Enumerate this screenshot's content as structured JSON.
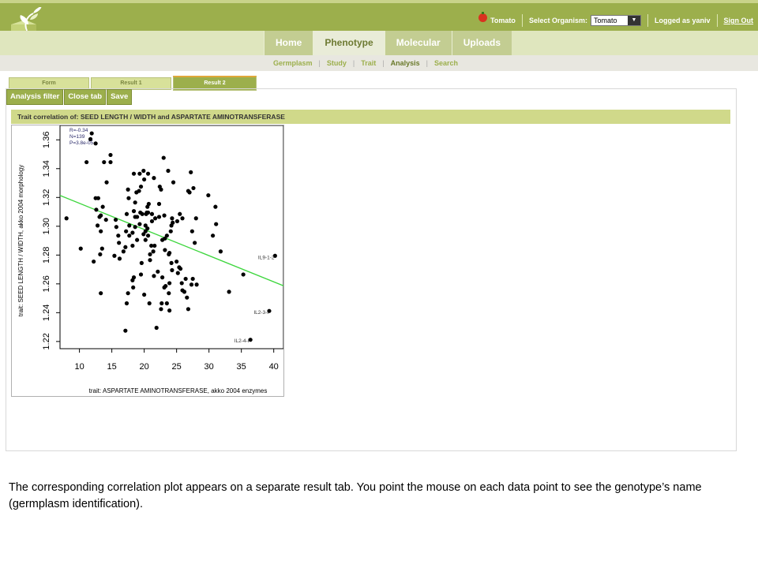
{
  "header": {
    "logo_icon": "leaf-logo-icon",
    "organism_label_brand": "Tomato",
    "select_organism_label": "Select Organism:",
    "organism_value": "Tomato",
    "logged_in_text": "Logged as yaniv",
    "signout_label": "Sign Out",
    "colors": {
      "header": "#9caf4c",
      "nav_band": "#dfe6be",
      "tab_active": "#e9ecd8",
      "accent": "#9caf4c"
    }
  },
  "nav": {
    "tabs": [
      {
        "label": "Home"
      },
      {
        "label": "Phenotype"
      },
      {
        "label": "Molecular"
      },
      {
        "label": "Uploads"
      }
    ],
    "subnav": [
      {
        "label": "Germplasm"
      },
      {
        "label": "Study"
      },
      {
        "label": "Trait"
      },
      {
        "label": "Analysis"
      },
      {
        "label": "Search"
      }
    ]
  },
  "inner_tabs": [
    {
      "label": "Form"
    },
    {
      "label": "Result 1"
    },
    {
      "label": "Result 2"
    }
  ],
  "toolbar": {
    "analysis_filter": "Analysis filter",
    "close_tab": "Close tab",
    "save": "Save"
  },
  "correlation_title": "Trait correlation of: SEED LENGTH / WIDTH and ASPARTATE AMINOTRANSFERASE",
  "caption": "The corresponding correlation plot appears on a separate result tab. You point the mouse on each data point to see the genotype’s name (germplasm identification).",
  "chart_data": {
    "type": "scatter",
    "xlabel": "trait: ASPARTATE AMINOTRANSFERASE, akko 2004 enzymes",
    "ylabel": "trait: SEED LENGTH / WIDTH, akko 2004 morphology",
    "xlim": [
      7,
      41.5
    ],
    "ylim": [
      1.215,
      1.37
    ],
    "xticks": [
      10,
      15,
      20,
      25,
      30,
      35,
      40
    ],
    "yticks": [
      1.22,
      1.24,
      1.26,
      1.28,
      1.3,
      1.32,
      1.34,
      1.36
    ],
    "stats": [
      "R=-0.34",
      "N=139",
      "P=3.8e-05"
    ],
    "regression_line": {
      "x": [
        7,
        41.5
      ],
      "y": [
        1.3214,
        1.2587
      ],
      "color": "#3dd63d"
    },
    "annotations": [
      {
        "text": "IL9-1-2",
        "x": 40.1,
        "y": 1.2793
      },
      {
        "text": "IL2-3-I",
        "x": 39.2,
        "y": 1.2412
      },
      {
        "text": "IL2-4-I",
        "x": 36.2,
        "y": 1.2215
      }
    ],
    "points": [
      [
        11.7,
        1.3605
      ],
      [
        11.9,
        1.3645
      ],
      [
        12.5,
        1.3575
      ],
      [
        11.1,
        1.3445
      ],
      [
        13.8,
        1.3445
      ],
      [
        14.8,
        1.3445
      ],
      [
        14.8,
        1.3495
      ],
      [
        14.2,
        1.3305
      ],
      [
        12.5,
        1.3195
      ],
      [
        12.9,
        1.3195
      ],
      [
        12.6,
        1.3115
      ],
      [
        13.6,
        1.3135
      ],
      [
        13.3,
        1.3075
      ],
      [
        13.1,
        1.3065
      ],
      [
        12.8,
        1.3005
      ],
      [
        14.1,
        1.3045
      ],
      [
        13.3,
        1.2965
      ],
      [
        13.5,
        1.2845
      ],
      [
        13.2,
        1.2805
      ],
      [
        12.2,
        1.2755
      ],
      [
        10.2,
        1.2845
      ],
      [
        8.0,
        1.3055
      ],
      [
        13.3,
        1.2535
      ],
      [
        15.7,
        1.2995
      ],
      [
        15.6,
        1.3045
      ],
      [
        17.3,
        1.3085
      ],
      [
        16.0,
        1.2935
      ],
      [
        16.8,
        1.2825
      ],
      [
        16.1,
        1.2885
      ],
      [
        15.4,
        1.2795
      ],
      [
        16.2,
        1.2775
      ],
      [
        17.2,
        1.2965
      ],
      [
        18.2,
        1.2955
      ],
      [
        18.6,
        1.3065
      ],
      [
        18.4,
        1.3105
      ],
      [
        18.9,
        1.3065
      ],
      [
        19.4,
        1.3095
      ],
      [
        19.7,
        1.3085
      ],
      [
        20.3,
        1.3085
      ],
      [
        20.6,
        1.3095
      ],
      [
        21.2,
        1.3085
      ],
      [
        21.7,
        1.3055
      ],
      [
        21.2,
        1.3035
      ],
      [
        20.5,
        1.2985
      ],
      [
        20.2,
        1.3005
      ],
      [
        19.9,
        1.2945
      ],
      [
        19.3,
        1.3015
      ],
      [
        18.6,
        1.2995
      ],
      [
        17.7,
        1.3005
      ],
      [
        17.7,
        1.2935
      ],
      [
        18.2,
        1.2865
      ],
      [
        17.1,
        1.2855
      ],
      [
        18.9,
        1.2905
      ],
      [
        20.2,
        1.2965
      ],
      [
        20.6,
        1.2935
      ],
      [
        20.2,
        1.2905
      ],
      [
        21.1,
        1.2865
      ],
      [
        21.6,
        1.2865
      ],
      [
        21.4,
        1.2825
      ],
      [
        20.9,
        1.2805
      ],
      [
        20.9,
        1.2765
      ],
      [
        19.6,
        1.2745
      ],
      [
        19.5,
        1.2665
      ],
      [
        18.4,
        1.2645
      ],
      [
        18.2,
        1.2625
      ],
      [
        18.3,
        1.2575
      ],
      [
        17.5,
        1.2535
      ],
      [
        17.3,
        1.2465
      ],
      [
        17.1,
        1.2275
      ],
      [
        20.0,
        1.2525
      ],
      [
        20.8,
        1.2465
      ],
      [
        21.9,
        1.2295
      ],
      [
        22.1,
        1.2685
      ],
      [
        21.5,
        1.2655
      ],
      [
        22.8,
        1.2645
      ],
      [
        23.3,
        1.2585
      ],
      [
        23.1,
        1.2575
      ],
      [
        23.9,
        1.2605
      ],
      [
        23.8,
        1.2535
      ],
      [
        22.7,
        1.2465
      ],
      [
        23.5,
        1.2465
      ],
      [
        23.9,
        1.2415
      ],
      [
        22.6,
        1.2425
      ],
      [
        24.3,
        1.2695
      ],
      [
        24.2,
        1.2745
      ],
      [
        23.8,
        1.2805
      ],
      [
        23.2,
        1.2835
      ],
      [
        22.8,
        1.2905
      ],
      [
        23.2,
        1.2915
      ],
      [
        23.5,
        1.2935
      ],
      [
        24.1,
        1.2965
      ],
      [
        24.2,
        1.3005
      ],
      [
        24.4,
        1.3025
      ],
      [
        25.1,
        1.3035
      ],
      [
        25.9,
        1.3055
      ],
      [
        25.5,
        1.3085
      ],
      [
        24.3,
        1.3055
      ],
      [
        23.1,
        1.3075
      ],
      [
        22.3,
        1.3065
      ],
      [
        22.3,
        1.3155
      ],
      [
        20.7,
        1.3155
      ],
      [
        20.5,
        1.3135
      ],
      [
        20.4,
        1.3095
      ],
      [
        18.6,
        1.3165
      ],
      [
        17.6,
        1.3195
      ],
      [
        17.5,
        1.3255
      ],
      [
        18.8,
        1.3235
      ],
      [
        19.2,
        1.3245
      ],
      [
        19.5,
        1.3275
      ],
      [
        20.0,
        1.3325
      ],
      [
        19.3,
        1.3365
      ],
      [
        19.9,
        1.3385
      ],
      [
        20.6,
        1.3365
      ],
      [
        18.4,
        1.3365
      ],
      [
        21.5,
        1.3335
      ],
      [
        22.4,
        1.3275
      ],
      [
        22.6,
        1.3255
      ],
      [
        23.7,
        1.3385
      ],
      [
        24.5,
        1.3305
      ],
      [
        23.0,
        1.3475
      ],
      [
        26.8,
        1.3245
      ],
      [
        27.0,
        1.3235
      ],
      [
        27.2,
        1.3375
      ],
      [
        27.6,
        1.3265
      ],
      [
        29.9,
        1.3215
      ],
      [
        31.0,
        1.3135
      ],
      [
        31.1,
        1.3015
      ],
      [
        30.6,
        1.2935
      ],
      [
        28.0,
        1.3055
      ],
      [
        27.4,
        1.2965
      ],
      [
        27.8,
        1.2885
      ],
      [
        31.8,
        1.2825
      ],
      [
        33.1,
        1.2545
      ],
      [
        35.3,
        1.2665
      ],
      [
        25.8,
        1.2605
      ],
      [
        25.9,
        1.2555
      ],
      [
        26.2,
        1.2545
      ],
      [
        26.6,
        1.2505
      ],
      [
        25.2,
        1.2675
      ],
      [
        25.6,
        1.2705
      ],
      [
        25.4,
        1.2715
      ],
      [
        25.0,
        1.2755
      ],
      [
        26.4,
        1.2635
      ],
      [
        27.3,
        1.2595
      ],
      [
        27.5,
        1.2635
      ],
      [
        28.1,
        1.2595
      ],
      [
        26.8,
        1.2425
      ],
      [
        23.9,
        1.2815
      ],
      [
        40.2,
        1.2795
      ],
      [
        39.3,
        1.2412
      ],
      [
        36.4,
        1.2212
      ]
    ]
  }
}
